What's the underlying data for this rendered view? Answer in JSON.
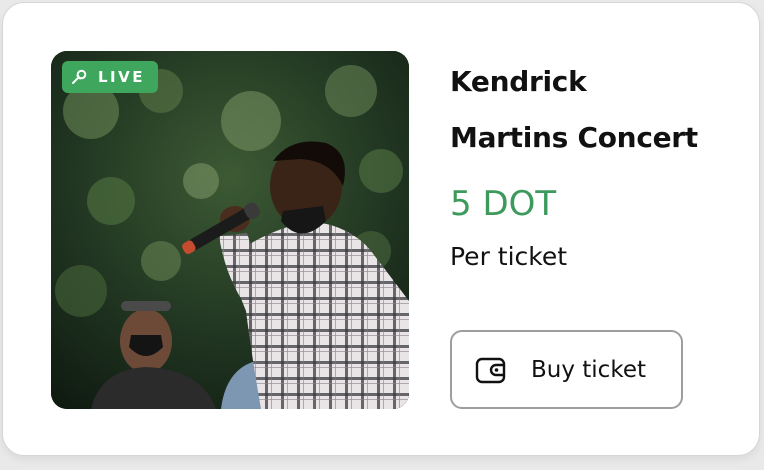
{
  "card": {
    "badge": {
      "label": "LIVE",
      "icon": "microphone-icon",
      "color": "#3fa75d"
    },
    "image": {
      "subject": "concert-performer-photo"
    },
    "title_line1": "Kendrick",
    "title_line2": "Martins Concert",
    "price": "5 DOT",
    "price_color": "#3d9a5c",
    "price_note": "Per ticket",
    "buy_button": {
      "label": "Buy ticket",
      "icon": "wallet-icon"
    }
  }
}
